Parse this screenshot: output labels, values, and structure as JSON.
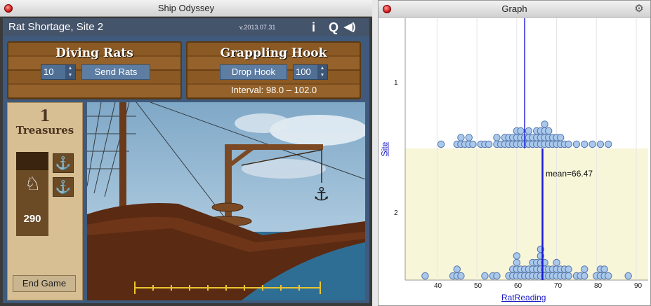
{
  "left_window": {
    "title": "Ship Odyssey"
  },
  "game": {
    "site_title": "Rat Shortage, Site 2",
    "version": "v.2013.07.31",
    "icons": [
      "info-icon",
      "quit-icon",
      "sound-icon"
    ],
    "info_glyph": "i",
    "quit_glyph": "Q",
    "sound_glyph": "◀)",
    "diving": {
      "title": "Diving Rats",
      "count": "10",
      "button": "Send Rats"
    },
    "grappling": {
      "title": "Grappling Hook",
      "button": "Drop Hook",
      "count": "100",
      "interval": "Interval:  98.0 – 102.0"
    },
    "treasures": {
      "count": "1",
      "label": "Treasures"
    },
    "rats_remaining": "290",
    "end_button": "End Game"
  },
  "right_window": {
    "title": "Graph"
  },
  "graph": {
    "y_label": "Site",
    "x_label": "RatReading",
    "y_categories": [
      "1",
      "2"
    ],
    "x_ticks": [
      "40",
      "50",
      "60",
      "70",
      "80",
      "90"
    ],
    "mean_label": "mean=66.47",
    "colors": {
      "dot_fill": "#a9c8ec",
      "dot_stroke": "#4f72a8",
      "line": "#1a1ad6",
      "band": "#f8f6d9"
    }
  },
  "chart_data": {
    "type": "scatter",
    "xlabel": "RatReading",
    "ylabel": "Site",
    "xlim": [
      32,
      93
    ],
    "series": [
      {
        "name": "1",
        "mean": 62,
        "values": [
          41,
          45,
          46,
          46,
          47,
          48,
          48,
          49,
          51,
          52,
          53,
          55,
          55,
          56,
          57,
          57,
          58,
          58,
          59,
          59,
          60,
          60,
          60,
          61,
          61,
          61,
          62,
          62,
          63,
          63,
          63,
          64,
          64,
          65,
          65,
          65,
          66,
          66,
          66,
          67,
          67,
          67,
          67,
          68,
          68,
          68,
          69,
          69,
          70,
          70,
          71,
          71,
          72,
          73,
          75,
          77,
          79,
          81,
          83
        ]
      },
      {
        "name": "2",
        "mean": 66.47,
        "values": [
          37,
          44,
          45,
          45,
          46,
          52,
          54,
          55,
          58,
          59,
          59,
          60,
          60,
          60,
          60,
          61,
          61,
          62,
          62,
          63,
          63,
          64,
          64,
          64,
          65,
          65,
          65,
          66,
          66,
          66,
          66,
          66,
          67,
          67,
          67,
          68,
          68,
          69,
          69,
          70,
          70,
          70,
          71,
          71,
          72,
          72,
          73,
          73,
          75,
          76,
          77,
          77,
          80,
          81,
          81,
          82,
          82,
          83,
          88
        ]
      }
    ]
  }
}
